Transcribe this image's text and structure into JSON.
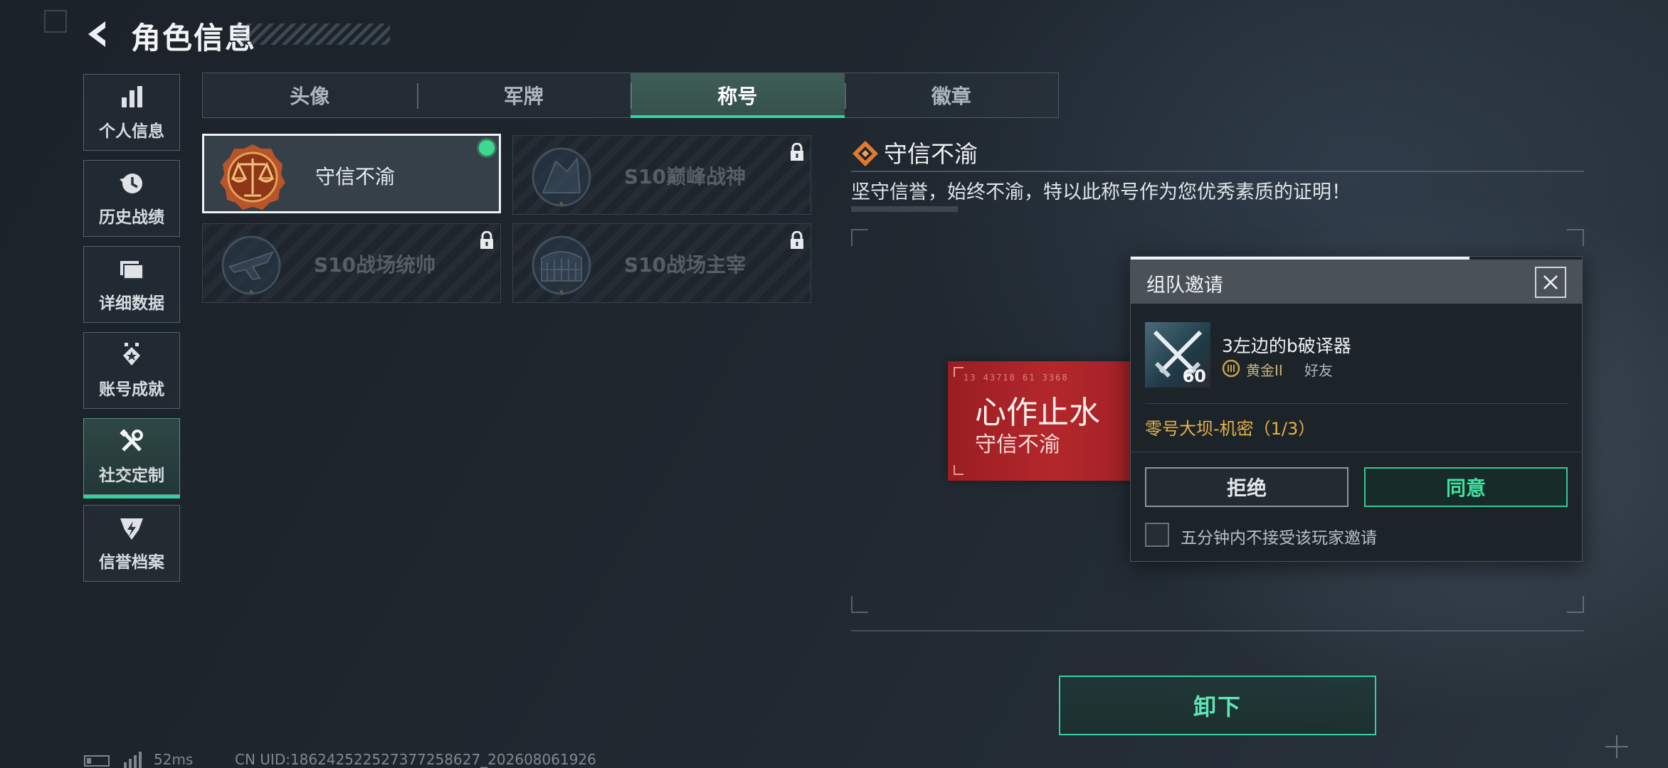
{
  "header": {
    "title": "角色信息"
  },
  "sidebar": {
    "items": [
      {
        "label": "个人信息",
        "icon": "bar-chart-icon"
      },
      {
        "label": "历史战绩",
        "icon": "history-icon"
      },
      {
        "label": "详细数据",
        "icon": "folder-icon"
      },
      {
        "label": "账号成就",
        "icon": "achievement-icon"
      },
      {
        "label": "社交定制",
        "icon": "tools-icon",
        "active": true
      },
      {
        "label": "信誉档案",
        "icon": "reputation-icon"
      }
    ]
  },
  "tabs": [
    {
      "label": "头像"
    },
    {
      "label": "军牌"
    },
    {
      "label": "称号",
      "active": true
    },
    {
      "label": "徽章"
    }
  ],
  "cards": [
    {
      "label": "守信不渝",
      "selected": true,
      "equipped": true,
      "locked": false,
      "icon": "scales-medal-icon"
    },
    {
      "label": "S10巅峰战神",
      "locked": true,
      "icon": "peak-medal-icon"
    },
    {
      "label": "S10战场统帅",
      "locked": true,
      "icon": "aircraft-medal-icon"
    },
    {
      "label": "S10战场主宰",
      "locked": true,
      "icon": "colosseum-medal-icon"
    }
  ],
  "detail": {
    "title": "守信不渝",
    "description": "坚守信誉，始终不渝，特以此称号作为您优秀素质的证明！",
    "banner_main": "心作止水",
    "banner_sub": "守信不渝",
    "unequip_label": "卸下"
  },
  "invite": {
    "title": "组队邀请",
    "player_name": "3左边的b破译器",
    "level": "60",
    "rank": "黄金II",
    "relation": "好友",
    "mode": "零号大坝-机密（1/3）",
    "reject_label": "拒绝",
    "accept_label": "同意",
    "mute_label": "五分钟内不接受该玩家邀请",
    "progress": 0.75
  },
  "footer": {
    "ping": "52ms",
    "uid": "CN UID:186242522527377258627_202608061926"
  },
  "colors": {
    "accent_green": "#33d1a0",
    "equipped_dot": "#3ed98e",
    "banner_red": "#b3272c",
    "mode_gold": "#e4b14a",
    "detail_icon_orange": "#e07a2e"
  }
}
